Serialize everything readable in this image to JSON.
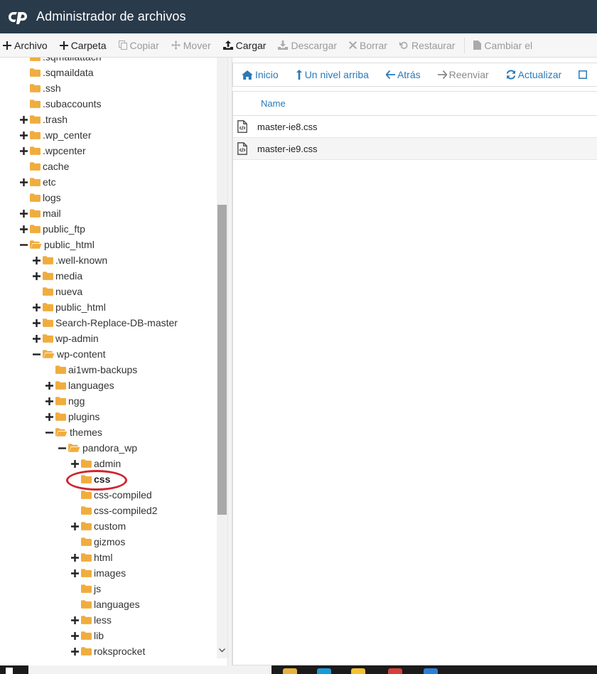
{
  "header": {
    "title": "Administrador de archivos"
  },
  "toolbar": {
    "archivo": "Archivo",
    "carpeta": "Carpeta",
    "copiar": "Copiar",
    "mover": "Mover",
    "cargar": "Cargar",
    "descargar": "Descargar",
    "borrar": "Borrar",
    "restaurar": "Restaurar",
    "cambiar": "Cambiar el"
  },
  "nav": {
    "inicio": "Inicio",
    "arriba": "Un nivel arriba",
    "atras": "Atrás",
    "reenviar": "Reenviar",
    "actualizar": "Actualizar"
  },
  "table": {
    "header_name": "Name",
    "files": [
      {
        "name": "master-ie8.css"
      },
      {
        "name": "master-ie9.css"
      }
    ]
  },
  "tree": {
    "items": [
      {
        "label": ".sqmailattach",
        "state": "none"
      },
      {
        "label": ".sqmaildata",
        "state": "none"
      },
      {
        "label": ".ssh",
        "state": "none"
      },
      {
        "label": ".subaccounts",
        "state": "none"
      },
      {
        "label": ".trash",
        "state": "collapsed"
      },
      {
        "label": ".wp_center",
        "state": "collapsed"
      },
      {
        "label": ".wpcenter",
        "state": "collapsed"
      },
      {
        "label": "cache",
        "state": "none"
      },
      {
        "label": "etc",
        "state": "collapsed"
      },
      {
        "label": "logs",
        "state": "none"
      },
      {
        "label": "mail",
        "state": "collapsed"
      },
      {
        "label": "public_ftp",
        "state": "collapsed"
      },
      {
        "label": "public_html",
        "state": "expanded"
      },
      {
        "label": ".well-known",
        "state": "collapsed"
      },
      {
        "label": "media",
        "state": "collapsed"
      },
      {
        "label": "nueva",
        "state": "none"
      },
      {
        "label": "public_html",
        "state": "collapsed"
      },
      {
        "label": "Search-Replace-DB-master",
        "state": "collapsed"
      },
      {
        "label": "wp-admin",
        "state": "collapsed"
      },
      {
        "label": "wp-content",
        "state": "expanded"
      },
      {
        "label": "ai1wm-backups",
        "state": "none"
      },
      {
        "label": "languages",
        "state": "collapsed"
      },
      {
        "label": "ngg",
        "state": "collapsed"
      },
      {
        "label": "plugins",
        "state": "collapsed"
      },
      {
        "label": "themes",
        "state": "expanded"
      },
      {
        "label": "pandora_wp",
        "state": "expanded"
      },
      {
        "label": "admin",
        "state": "collapsed"
      },
      {
        "label": "css",
        "state": "selected"
      },
      {
        "label": "css-compiled",
        "state": "none"
      },
      {
        "label": "css-compiled2",
        "state": "none"
      },
      {
        "label": "custom",
        "state": "collapsed"
      },
      {
        "label": "gizmos",
        "state": "none"
      },
      {
        "label": "html",
        "state": "collapsed"
      },
      {
        "label": "images",
        "state": "collapsed"
      },
      {
        "label": "js",
        "state": "none"
      },
      {
        "label": "languages",
        "state": "none"
      },
      {
        "label": "less",
        "state": "collapsed"
      },
      {
        "label": "lib",
        "state": "collapsed"
      },
      {
        "label": "roksprocket",
        "state": "collapsed"
      }
    ]
  },
  "colors": {
    "header_bg": "#293a4a",
    "link": "#2a79b8",
    "folder": "#f0ad3e",
    "highlight": "#d0242e"
  }
}
